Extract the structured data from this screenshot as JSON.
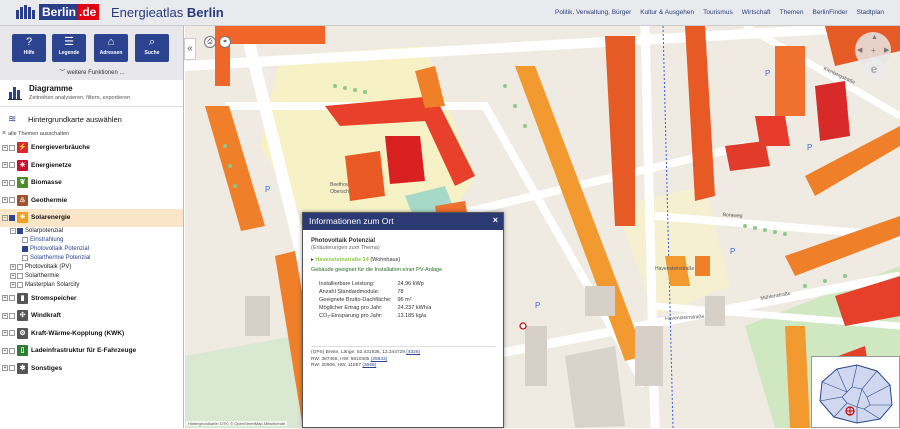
{
  "header": {
    "logo_main": "Berlin",
    "logo_suffix": ".de",
    "app_title_prefix": "Energieatlas",
    "app_title_bold": "Berlin",
    "nav": [
      "Politik, Verwaltung, Bürger",
      "Kultur & Ausgehen",
      "Tourismus",
      "Wirtschaft",
      "Themen",
      "BerlinFinder",
      "Stadtplan"
    ]
  },
  "toolbar": {
    "buttons": [
      {
        "label": "Hilfe",
        "icon": "?"
      },
      {
        "label": "Legende",
        "icon": "☰"
      },
      {
        "label": "Adressen",
        "icon": "⌂"
      },
      {
        "label": "Suche",
        "icon": "⌕"
      }
    ],
    "more": "weitere Funktionen ..."
  },
  "diagramme": {
    "title": "Diagramme",
    "subtitle": "Zeitreihen analysieren, filtern, exportieren"
  },
  "basemap": {
    "label": "Hintergrundkarte auswählen"
  },
  "hide_all": "alle Themen ausschalten",
  "layers": [
    {
      "label": "Energieverbräuche",
      "color": "#d9282f",
      "glyph": "⚡"
    },
    {
      "label": "Energienetze",
      "color": "#c8102e",
      "glyph": "✳"
    },
    {
      "label": "Biomasse",
      "color": "#4c8c2b",
      "glyph": "❦"
    },
    {
      "label": "Geothermie",
      "color": "#a0522d",
      "glyph": "♨"
    },
    {
      "label": "Solarenergie",
      "color": "#f0a020",
      "glyph": "☀"
    }
  ],
  "solar_sub": {
    "potenzial": "Solarpotenzial",
    "items": [
      "Einstrahlung",
      "Photovoltaik Potenzial",
      "Solarthermie Potenzial"
    ],
    "after": [
      "Photovoltaik (PV)",
      "Solarthermie",
      "Masterplan Solarcity"
    ]
  },
  "layers_bottom": [
    {
      "label": "Stromspeicher",
      "color": "#555555",
      "glyph": "▮"
    },
    {
      "label": "Windkraft",
      "color": "#555555",
      "glyph": "✣"
    },
    {
      "label": "Kraft-Wärme-Kopplung (KWK)",
      "color": "#555555",
      "glyph": "⚙"
    },
    {
      "label": "Ladeinfrastruktur für E-Fahrzeuge",
      "color": "#2f7d32",
      "glyph": "▯"
    },
    {
      "label": "Sonstiges",
      "color": "#555555",
      "glyph": "✱"
    }
  ],
  "map": {
    "streets": [
      "Havensteinstraße",
      "Boraweg",
      "Mühlenstraße",
      "Havensteinstraße",
      "Kienbergstraße"
    ],
    "school_label_1": "Beethov",
    "school_label_2": "Obersch",
    "attribution": "Hintergrundkarte: DTK; © OpenStreetMap-Mitwirkende"
  },
  "popup": {
    "title": "Informationen zum Ort",
    "section_title": "Photovoltaik Potenzial",
    "section_sub": "(Erläuterungen zum Thema)",
    "address": "Havensteinstraße 14",
    "address_type": "(Wohnhaus)",
    "note": "Gebäude geeignet für die Installation einer PV-Anlage",
    "rows": [
      {
        "k": "Installierbare Leistung:",
        "v": "24,96 kWp"
      },
      {
        "k": "Anzahl Standardmodule:",
        "v": "78"
      },
      {
        "k": "Geeignete Brutto-Dachfläche:",
        "v": "96 m²"
      },
      {
        "k": "Möglicher Ertrag pro Jahr:",
        "v": "24.237 kWh/a"
      },
      {
        "k": "CO₂-Einsparung pro Jahr:",
        "v": "13.185 kg/a"
      }
    ],
    "coords_1": "(GPS) Breite, Länge: 52.431936, 13.344729",
    "coords_1_link": "(4326)",
    "coords_2": "RW: 387468, HW: 5810385",
    "coords_2_link": "(25833)",
    "coords_3": "RW: 20906, HW: 11857",
    "coords_3_link": "(3068)"
  },
  "colors": {
    "accent": "#2c4490",
    "header_bg": "#e9eaee",
    "popup_header": "#2c3a73",
    "active_layer_bg": "#fbe5c8"
  }
}
